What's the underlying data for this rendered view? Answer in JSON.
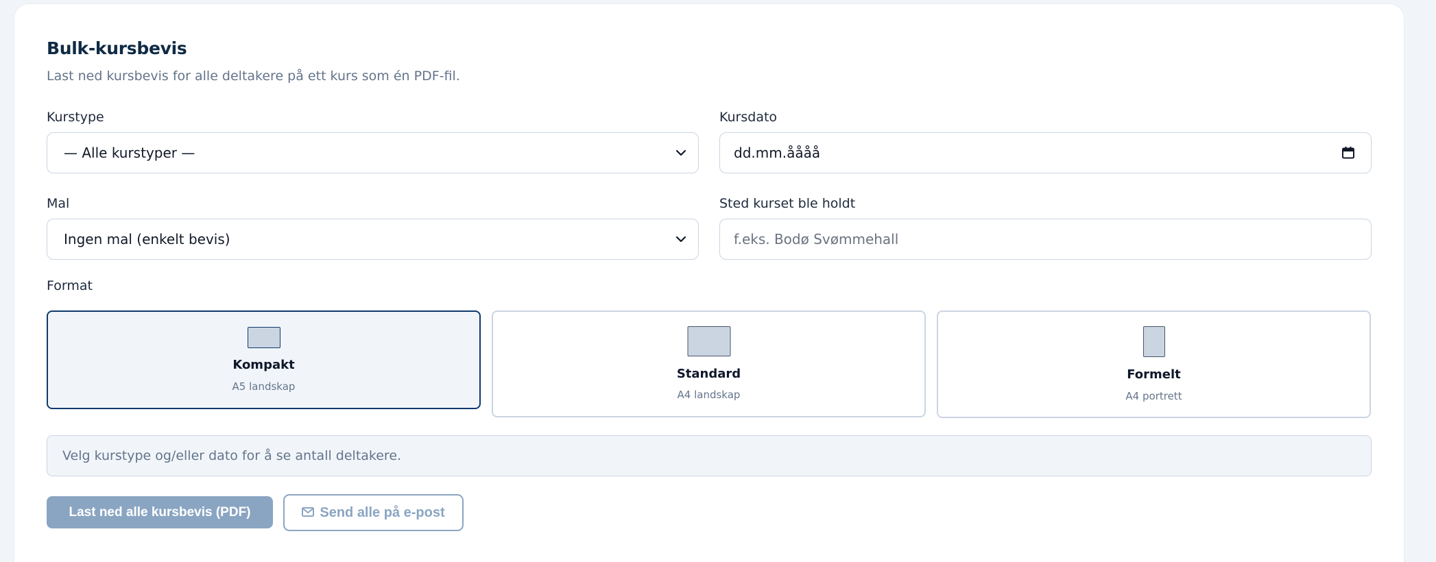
{
  "header": {
    "title": "Bulk-kursbevis",
    "subtitle": "Last ned kursbevis for alle deltakere på ett kurs som én PDF-fil."
  },
  "form": {
    "course_type": {
      "label": "Kurstype",
      "value": "— Alle kurstyper —"
    },
    "course_date": {
      "label": "Kursdato",
      "value": "dd.mm.åååå"
    },
    "template": {
      "label": "Mal",
      "value": "Ingen mal (enkelt bevis)"
    },
    "location": {
      "label": "Sted kurset ble holdt",
      "placeholder": "f.eks. Bodø Svømmehall"
    },
    "format": {
      "label": "Format",
      "selected": "Kompakt",
      "options": [
        {
          "name": "Kompakt",
          "sub": "A5 landskap"
        },
        {
          "name": "Standard",
          "sub": "A4 landskap"
        },
        {
          "name": "Formelt",
          "sub": "A4 portrett"
        }
      ]
    }
  },
  "info": {
    "text": "Velg kurstype og/eller dato for å se antall deltakere."
  },
  "actions": {
    "download_label": "Last ned alle kursbevis (PDF)",
    "email_label": "Send alle på e-post"
  },
  "colors": {
    "accent": "#0f3a6b",
    "disabled_button": "#8aa5c2",
    "info_bg": "#f1f5f9"
  },
  "icons": {
    "select": "chevron-down-icon",
    "date": "calendar-icon",
    "email": "envelope-icon"
  }
}
